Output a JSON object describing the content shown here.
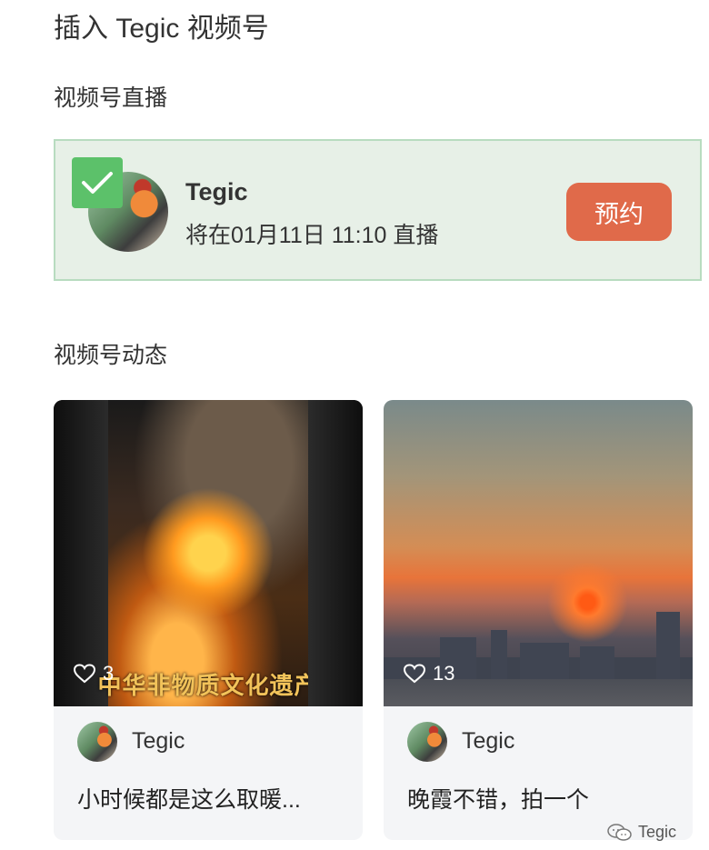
{
  "page": {
    "title": "插入 Tegic 视频号"
  },
  "live": {
    "section_label": "视频号直播",
    "selected": true,
    "name": "Tegic",
    "schedule": "将在01月11日 11:10 直播",
    "reserve_label": "预约",
    "accent_color": "#e06a4a",
    "check_color": "#5cc16a"
  },
  "feed": {
    "section_label": "视频号动态",
    "posts": [
      {
        "author": "Tegic",
        "likes": "3",
        "text": "小时候都是这么取暖...",
        "video_caption": "中华非物质文化遗产",
        "thumb_icon": "campfire"
      },
      {
        "author": "Tegic",
        "likes": "13",
        "text": "晚霞不错，拍一个",
        "video_caption": "",
        "thumb_icon": "sunset"
      }
    ]
  },
  "watermark": {
    "text": "Tegic",
    "icon": "wechat-icon"
  }
}
